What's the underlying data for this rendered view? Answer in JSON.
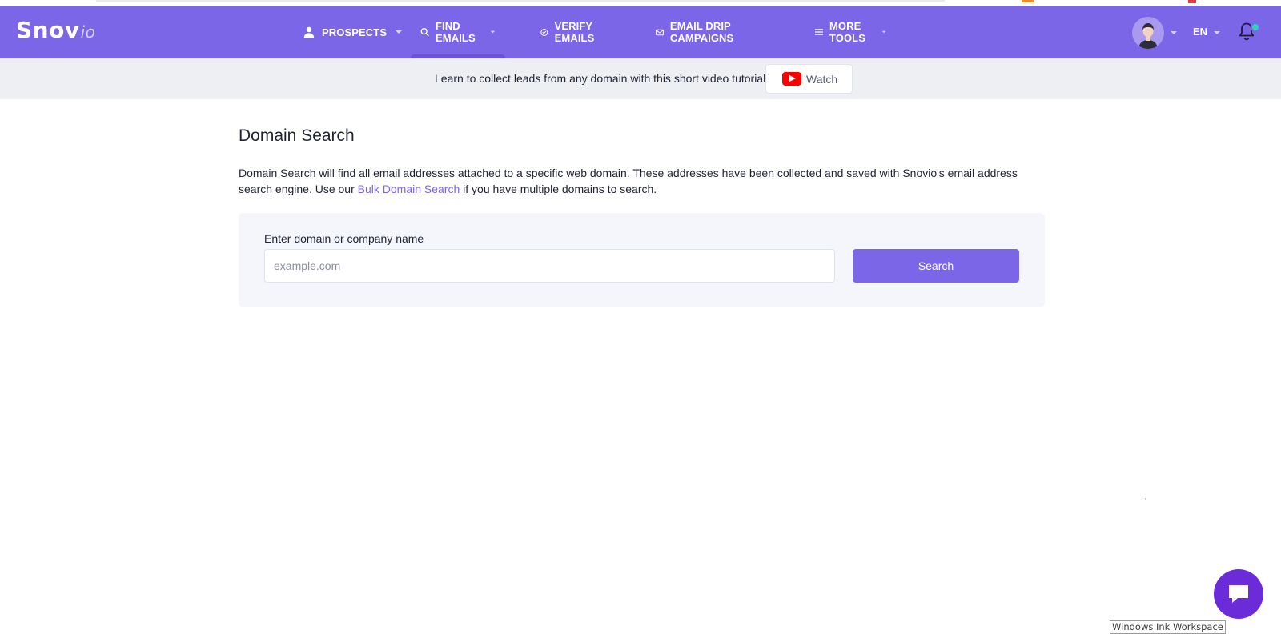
{
  "app": {
    "logo_main": "Snov",
    "logo_suffix": "io",
    "accent_color": "#7c66e8"
  },
  "nav": {
    "items": [
      {
        "label": "PROSPECTS",
        "icon": "person-icon",
        "has_dropdown": true
      },
      {
        "label": "FIND EMAILS",
        "icon": "search-icon",
        "has_dropdown": true,
        "active": true
      },
      {
        "label": "VERIFY EMAILS",
        "icon": "check-circle-icon",
        "has_dropdown": false
      },
      {
        "label": "EMAIL DRIP CAMPAIGNS",
        "icon": "envelope-icon",
        "has_dropdown": false
      },
      {
        "label": "MORE TOOLS",
        "icon": "menu-icon",
        "has_dropdown": true
      }
    ],
    "language": "EN",
    "notification_dot_color": "#2ed3b7"
  },
  "tutorial": {
    "text": "Learn to collect leads from any domain with this short video tutorial",
    "watch_label": "Watch",
    "icon": "youtube-icon"
  },
  "main": {
    "title": "Domain Search",
    "description_before_link": "Domain Search will find all email addresses attached to a specific web domain. These addresses have been collected and saved with Snovio's email address search engine. Use our ",
    "link_text": "Bulk Domain Search",
    "description_after_link": " if you have multiple domains to search.",
    "search": {
      "label": "Enter domain or company name",
      "placeholder": "example.com",
      "value": "",
      "button_label": "Search"
    }
  },
  "chat": {
    "icon": "chat-bubble-icon",
    "color": "#6c2bd9"
  },
  "os_overlay": {
    "ink_workspace_label": "Windows Ink Workspace"
  }
}
